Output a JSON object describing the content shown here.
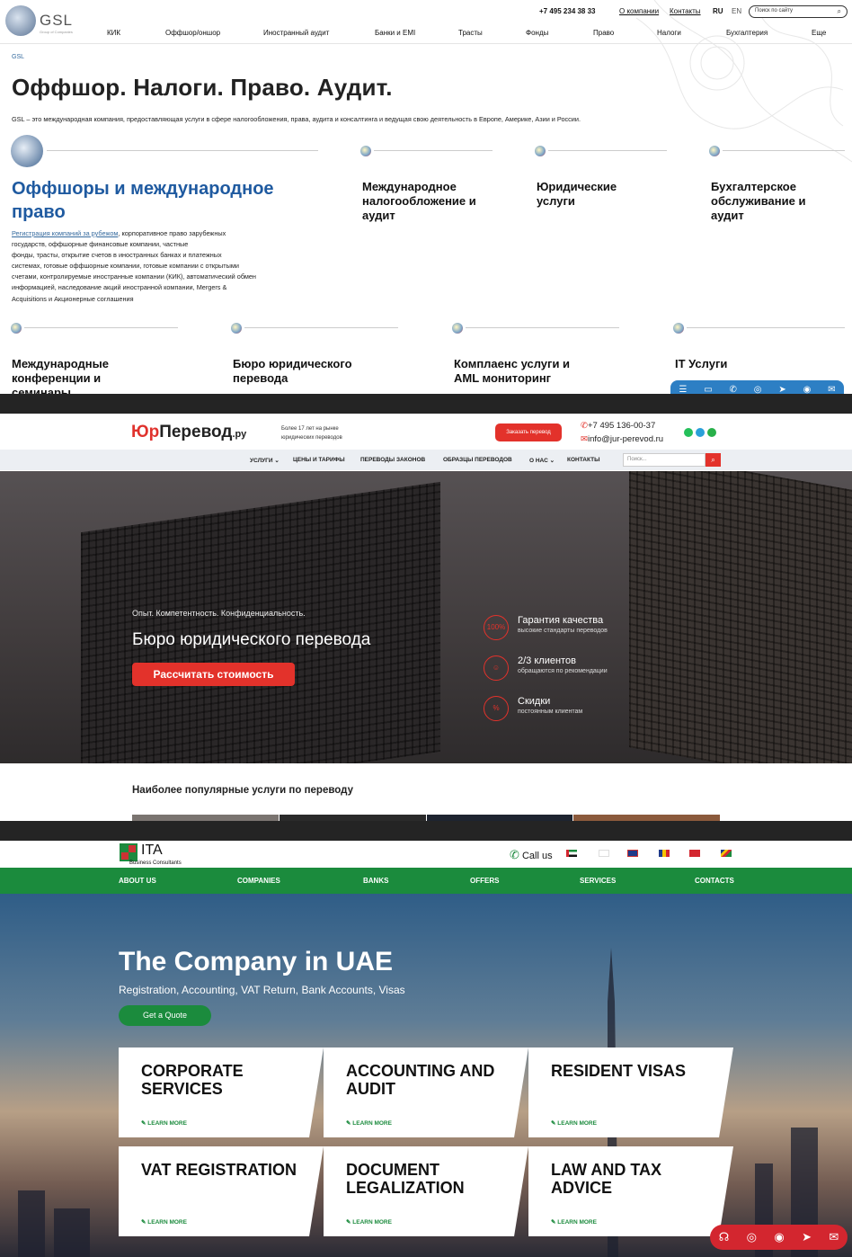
{
  "gsl": {
    "logo": "GSL",
    "logo_sub": "Group of Companies",
    "phone": "+7 495 234 38 33",
    "about": "О компании",
    "contacts": "Контакты",
    "lang_ru": "RU",
    "lang_en": "EN",
    "search_placeholder": "Поиск по сайту",
    "nav": [
      "КИК",
      "Оффшор/оншор",
      "Иностранный аудит",
      "Банки и EMI",
      "Трасты",
      "Фонды",
      "Право",
      "Налоги",
      "Бухгалтерия",
      "Еще"
    ],
    "breadcrumb": "GSL",
    "title": "Оффшор. Налоги. Право. Аудит.",
    "lead": "GSL – это международная компания, предоставляющая услуги в сфере налогообложения, права, аудита и консалтинга и ведущая свою деятельность в Европе, Америке, Азии и России.",
    "main_service": {
      "title_l1": "Оффшоры и международное",
      "title_l2": "право",
      "link": "Регистрация компаний за рубежом",
      "desc": [
        ", корпоративное право зарубежных",
        "государств, оффшорные финансовые компании, частные",
        "фонды, трасты, открытие счетов в иностранных банках и платежных",
        "системах, готовые оффшорные компании, готовые компании с открытыми",
        "счетами, контролируемые иностранные компании (КИК), автоматический обмен",
        "информацией, наследование акций иностранной компании, Mergers &",
        "Acquisitions и Акционерные соглашения"
      ]
    },
    "services_row1": [
      [
        "Международное",
        "налогообложение и",
        "аудит"
      ],
      [
        "Юридические",
        "услуги"
      ],
      [
        "Бухгалтерское",
        "обслуживание и",
        "аудит"
      ]
    ],
    "services_row2": [
      [
        "Международные",
        "конференции и",
        "семинары"
      ],
      [
        "Бюро юридического",
        "перевода"
      ],
      [
        "Комплаенс услуги и",
        "AML мониторинг"
      ],
      [
        "IT Услуги"
      ]
    ]
  },
  "jur": {
    "logo_a": "Юр",
    "logo_b": "Перевод",
    "logo_c": ".ру",
    "tag_l1": "Более 17 лет на рынке",
    "tag_l2": "юридических переводов",
    "order_btn": "Заказать перевод",
    "phone": "+7 495 136-00-37",
    "email": "info@jur-perevod.ru",
    "nav": [
      "УСЛУГИ",
      "ЦЕНЫ И ТАРИФЫ",
      "ПЕРЕВОДЫ ЗАКОНОВ",
      "ОБРАЗЦЫ ПЕРЕВОДОВ",
      "О НАС",
      "КОНТАКТЫ"
    ],
    "search_placeholder": "Поиск...",
    "hero_small": "Опыт. Компетентность. Конфиденциальность.",
    "hero_title": "Бюро юридического перевода",
    "hero_cta": "Рассчитать стоимость",
    "features": [
      {
        "icon": "100%",
        "title": "Гарантия качества",
        "sub": "высокие стандарты переводов"
      },
      {
        "icon": "☺",
        "title": "2/3 клиентов",
        "sub": "обращаются по рекомендации"
      },
      {
        "icon": "%",
        "title": "Скидки",
        "sub": "постоянным клиентам"
      }
    ],
    "popular": "Наиболее популярные услуги по переводу"
  },
  "ita": {
    "logo": "ITA",
    "logo_sub": "Business Consultants",
    "call": "Call us",
    "nav": [
      "ABOUT US",
      "COMPANIES",
      "BANKS",
      "OFFERS",
      "SERVICES",
      "CONTACTS"
    ],
    "hero_title": "The Company in UAE",
    "hero_sub": "Registration, Accounting, VAT Return, Bank Accounts, Visas",
    "quote_btn": "Get a Quote",
    "learn_more": "LEARN MORE",
    "cards": [
      [
        "CORPORATE",
        "SERVICES"
      ],
      [
        "ACCOUNTING AND",
        "AUDIT"
      ],
      [
        "RESIDENT VISAS"
      ],
      [
        "VAT REGISTRATION"
      ],
      [
        "DOCUMENT",
        "LEGALIZATION"
      ],
      [
        "LAW AND TAX",
        "ADVICE"
      ]
    ]
  },
  "colors": {
    "gsl_blue": "#1f5aa0",
    "jur_red": "#e3322b",
    "ita_green": "#1b8b3d",
    "ita_red": "#d3262f"
  }
}
